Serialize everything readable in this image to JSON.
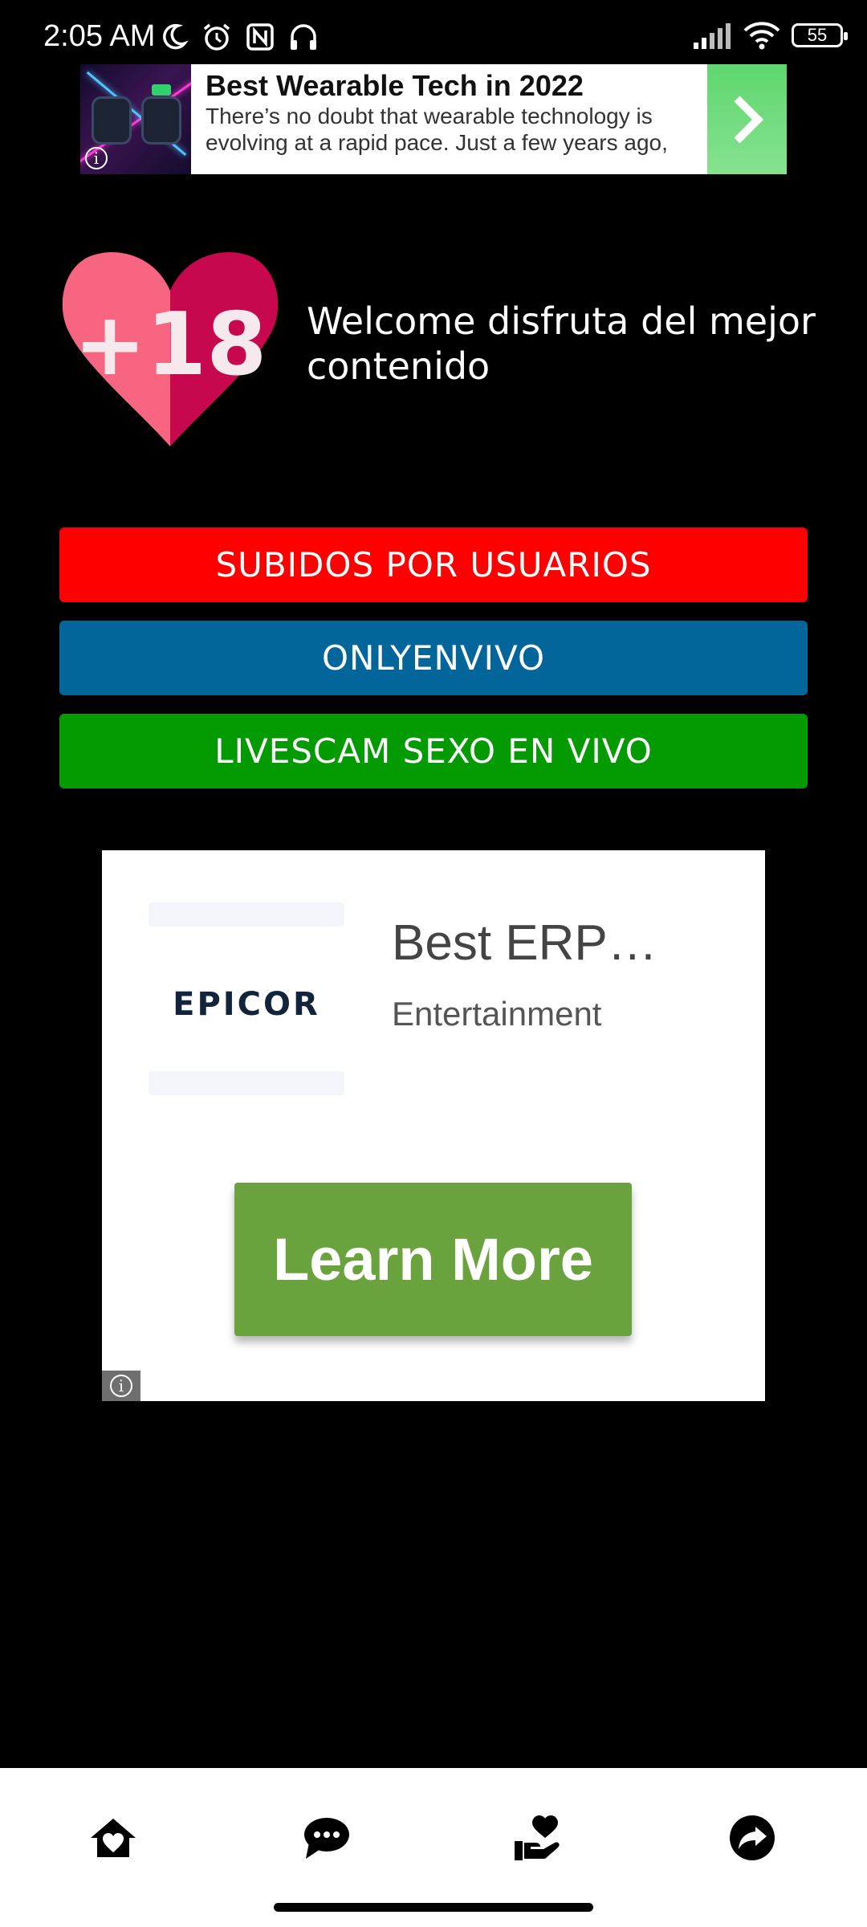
{
  "status_bar": {
    "time": "2:05 AM",
    "battery": "55",
    "icons_left": [
      "moon-icon",
      "alarm-icon",
      "nfc-icon",
      "headset-icon"
    ],
    "icons_right": [
      "signal-icon",
      "wifi-icon",
      "battery-icon"
    ]
  },
  "top_ad": {
    "title": "Best Wearable Tech in 2022",
    "description": "There’s no doubt that wearable technology is evolving at a rapid pace. Just a few years ago, t…",
    "info": "i",
    "arrow_icon": "chevron-right-icon",
    "arrow_color": "#6edb7c"
  },
  "hero": {
    "logo_text": "+18",
    "welcome": "Welcome  disfruta del mejor contenido",
    "logo_colors": {
      "left": "#f86580",
      "right": "#c8084e"
    }
  },
  "menu": {
    "buttons": [
      {
        "label": "SUBIDOS POR USUARIOS",
        "color": "#fe0000"
      },
      {
        "label": "ONLYENVIVO",
        "color": "#02669a"
      },
      {
        "label": "LIVESCAM SEXO EN VIVO",
        "color": "#039a02"
      }
    ]
  },
  "native_ad": {
    "logo_text": "EPICOR",
    "title": "Best ERP…",
    "category": "Entertainment",
    "cta": "Learn More",
    "cta_color": "#6aa23d",
    "info": "i"
  },
  "bottom_nav": {
    "items": [
      {
        "icon": "home-heart-icon"
      },
      {
        "icon": "chat-bubble-icon"
      },
      {
        "icon": "hand-heart-icon"
      },
      {
        "icon": "share-icon"
      }
    ]
  }
}
